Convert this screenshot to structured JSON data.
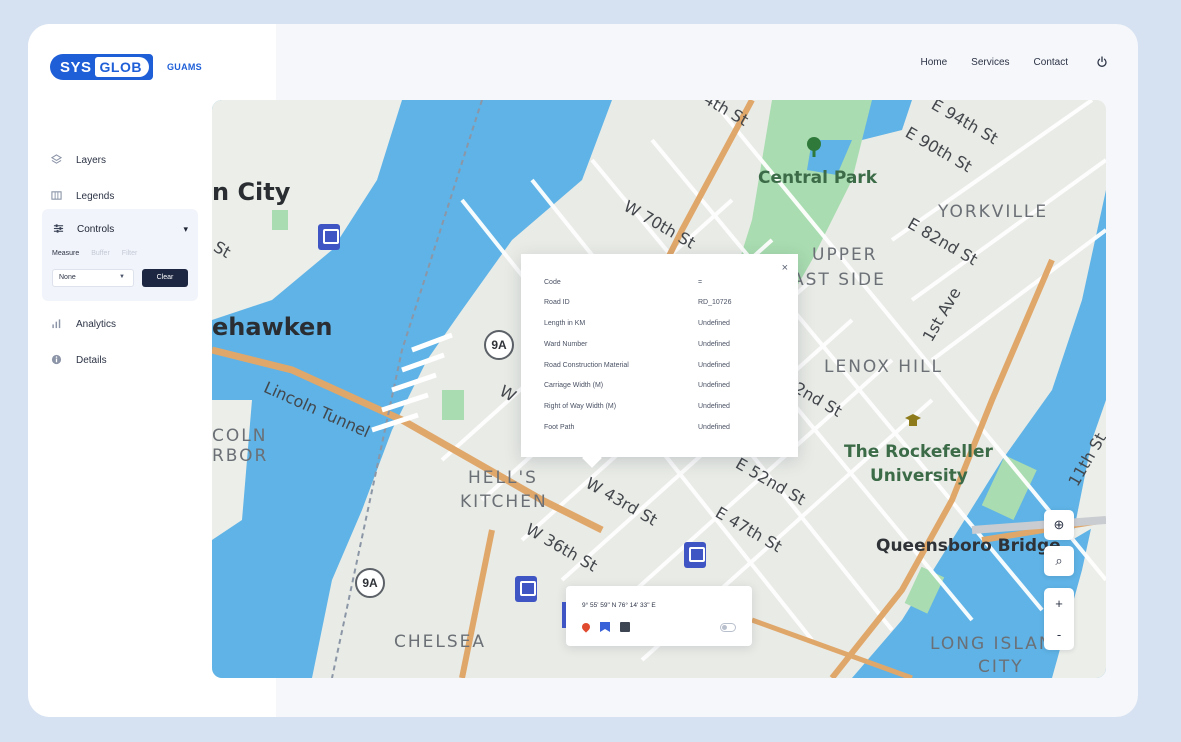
{
  "brand": {
    "logo_left": "SYS",
    "logo_right": "GLOB",
    "subtitle": "GUAMS",
    "accent": "#1e5fd8"
  },
  "topnav": {
    "home": "Home",
    "services": "Services",
    "contact": "Contact",
    "power_icon": "power-icon"
  },
  "sidebar": {
    "items": [
      {
        "label": "Layers",
        "icon": "layers-icon"
      },
      {
        "label": "Legends",
        "icon": "legends-icon"
      },
      {
        "label": "Controls",
        "icon": "sliders-icon"
      },
      {
        "label": "Analytics",
        "icon": "bar-chart-icon"
      },
      {
        "label": "Details",
        "icon": "info-icon"
      }
    ],
    "controls": {
      "tabs": [
        "Measure",
        "Buffer",
        "Filter"
      ],
      "select_value": "None",
      "clear_label": "Clear"
    }
  },
  "map": {
    "labels": {
      "city": "n City",
      "weehawken": "ehawken",
      "central_park": "Central Park",
      "yorkville": "YORKVILLE",
      "upper": "UPPER",
      "east_side": "AST SIDE",
      "lenox_hill": "LENOX HILL",
      "hells": "HELL'S",
      "kitchen": "KITCHEN",
      "chelsea": "CHELSEA",
      "rockefeller_1": "The Rockefeller",
      "rockefeller_2": "University",
      "queensboro": "Queensboro Bridge",
      "long_island_1": "LONG ISLAND",
      "long_island_2": "CITY",
      "lincoln_tunnel": "Lincoln Tunnel",
      "w70": "W 70th St",
      "w43": "W 43rd St",
      "w36": "W 36th St",
      "e52": "E 52nd St",
      "e47": "E 47th St",
      "e94": "E 94th St",
      "e90": "E 90th St",
      "e82": "E 82nd St",
      "first_ave": "1st Ave",
      "th_st": "4th St",
      "nd_st": "2nd St",
      "eleventh": "11th St",
      "colon": "COLN",
      "rbor": "RBOR",
      "route_9a": "9A",
      "st": "St",
      "w_frag": "W"
    },
    "popup": {
      "rows": [
        {
          "key": "Code",
          "value": "="
        },
        {
          "key": "Road ID",
          "value": "RD_10726"
        },
        {
          "key": "Length in KM",
          "value": "Undefined"
        },
        {
          "key": "Ward Number",
          "value": "Undefined"
        },
        {
          "key": "Road Construction Material",
          "value": "Undefined"
        },
        {
          "key": "Carriage Width (M)",
          "value": "Undefined"
        },
        {
          "key": "Right of Way Width (M)",
          "value": "Undefined"
        },
        {
          "key": "Foot Path",
          "value": "Undefined"
        }
      ],
      "close": "×"
    },
    "coordinates": "9° 55' 59\" N 76° 14' 33\" E",
    "controls": {
      "locate": "⊕",
      "search": "⌕",
      "zoom_in": "+",
      "zoom_out": "-"
    }
  }
}
